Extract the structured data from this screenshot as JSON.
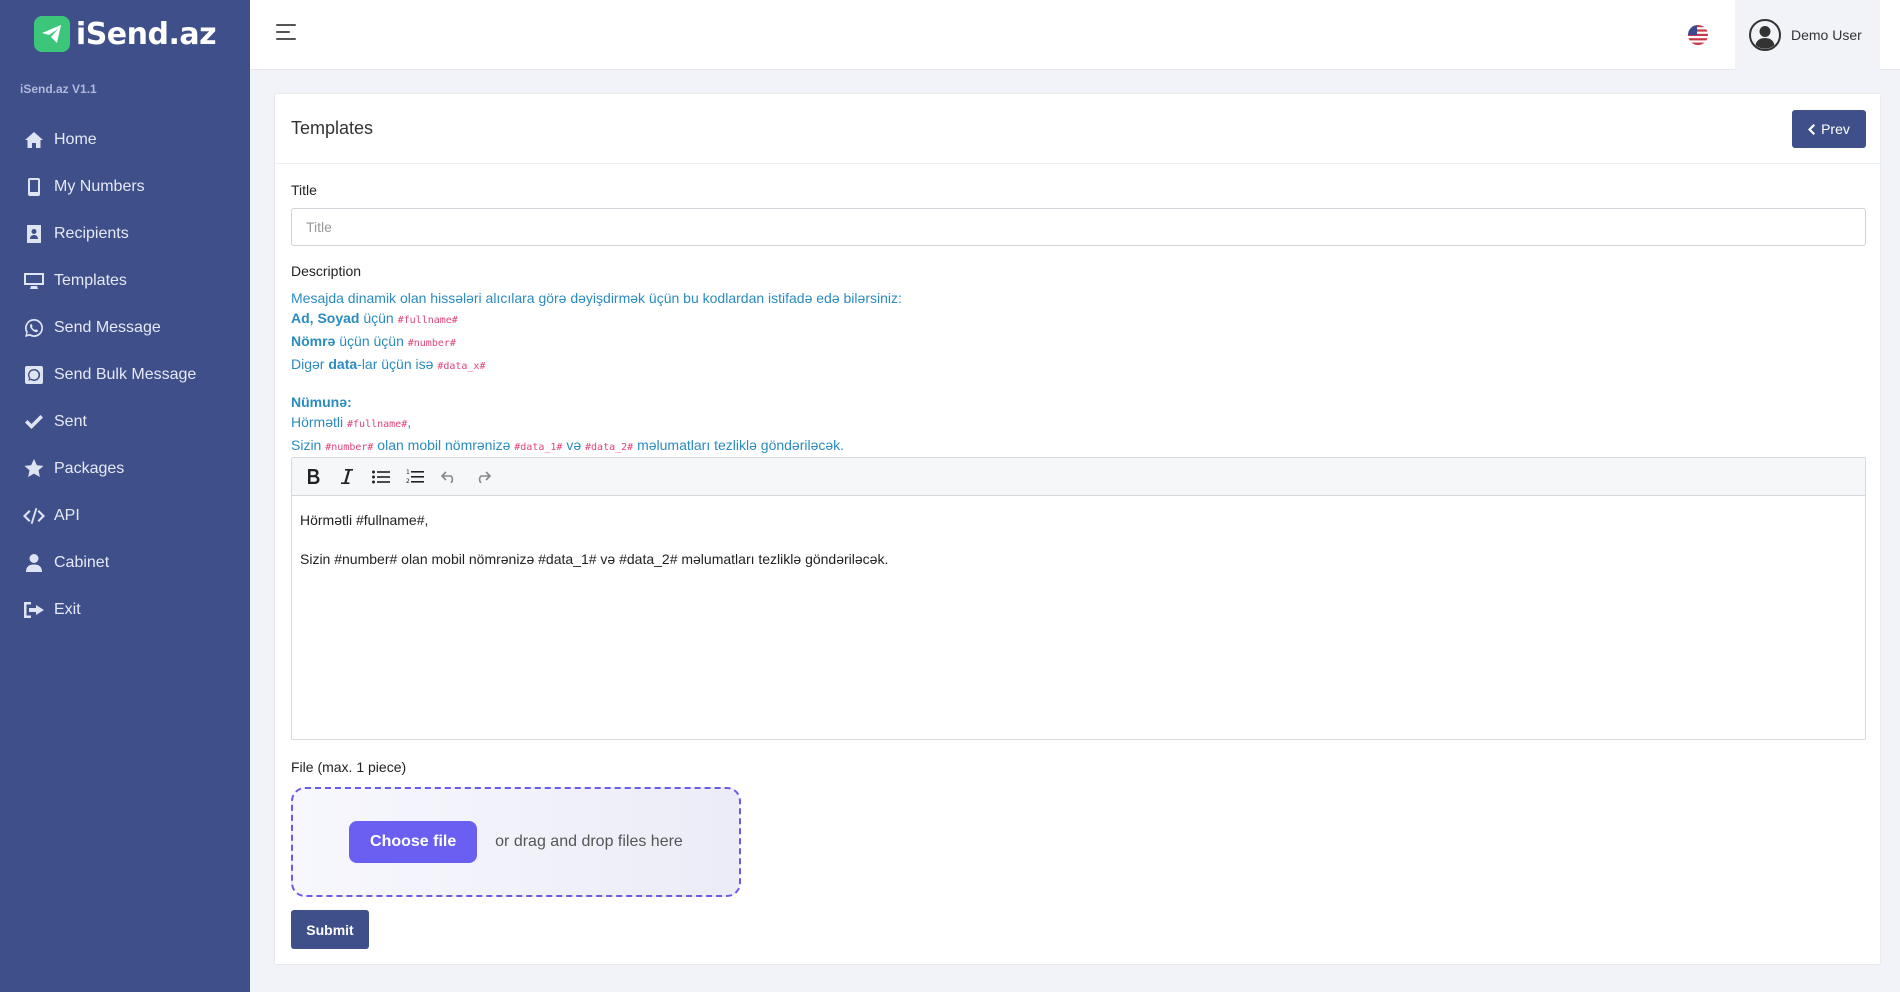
{
  "brand": {
    "name": "iSend.az",
    "version": "iSend.az V1.1"
  },
  "sidebar": {
    "items": [
      {
        "label": "Home",
        "icon": "home-icon"
      },
      {
        "label": "My Numbers",
        "icon": "mobile-icon"
      },
      {
        "label": "Recipients",
        "icon": "address-book-icon"
      },
      {
        "label": "Templates",
        "icon": "desktop-icon"
      },
      {
        "label": "Send Message",
        "icon": "whatsapp-icon"
      },
      {
        "label": "Send Bulk Message",
        "icon": "whatsapp-square-icon"
      },
      {
        "label": "Sent",
        "icon": "check-icon"
      },
      {
        "label": "Packages",
        "icon": "star-icon"
      },
      {
        "label": "API",
        "icon": "code-icon"
      },
      {
        "label": "Cabinet",
        "icon": "user-icon"
      },
      {
        "label": "Exit",
        "icon": "sign-out-icon"
      }
    ]
  },
  "topbar": {
    "user_name": "Demo User"
  },
  "page": {
    "title": "Templates",
    "prev_label": "Prev"
  },
  "form": {
    "title_label": "Title",
    "title_placeholder": "Title",
    "description_label": "Description",
    "desc": {
      "intro": "Mesajda dinamik olan hissələri alıcılara görə dəyişdirmək üçün bu kodlardan istifadə edə bilərsiniz:",
      "line1_bold": "Ad, Soyad",
      "line1_text": " üçün ",
      "line1_code": "#fullname#",
      "line2_bold": "Nömrə",
      "line2_text": " üçün üçün ",
      "line2_code": "#number#",
      "line3_pre": "Digər ",
      "line3_bold": "data",
      "line3_text": "-lar üçün isə ",
      "line3_code": "#data_x#",
      "example_label": "Nümunə:",
      "ex1_text": "Hörmətli ",
      "ex1_code": "#fullname#",
      "ex1_tail": ",",
      "ex2_a": "Sizin ",
      "ex2_code1": "#number#",
      "ex2_b": " olan mobil nömrənizə ",
      "ex2_code2": "#data_1#",
      "ex2_c": " və ",
      "ex2_code3": "#data_2#",
      "ex2_d": " məlumatları tezliklə göndəriləcək."
    },
    "editor": {
      "line1": "Hörmətli #fullname#,",
      "line2": "Sizin #number# olan mobil nömrənizə #data_1# və #data_2# məlumatları tezliklə göndəriləcək."
    },
    "file_label": "File (max. 1 piece)",
    "choose_file_label": "Choose file",
    "drop_text": "or drag and drop files here",
    "submit_label": "Submit"
  },
  "colors": {
    "sidebar_bg": "#3f4f8a",
    "accent": "#3f4f8a",
    "brand_green": "#3cc67a",
    "description_blue": "#2a8bbf",
    "code_pink": "#e0457b",
    "file_button": "#6a5ff0"
  }
}
